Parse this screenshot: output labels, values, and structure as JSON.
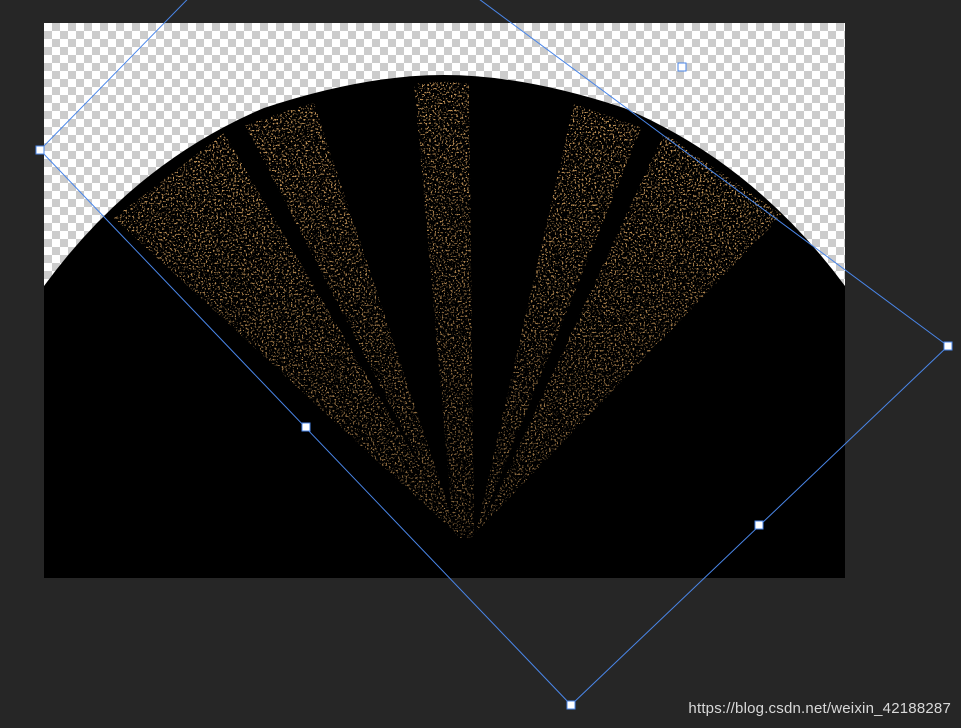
{
  "colors": {
    "workspace_bg": "#262626",
    "checker_light": "#ffffff",
    "checker_dark": "#cccccc",
    "image_fill": "#000000",
    "speckle": "#a0561c",
    "transform_box": "#4a86e8",
    "handle_fill": "#ffffff"
  },
  "canvas": {
    "layer_content": "fan-shaped sonar image on black"
  },
  "transform": {
    "handles": [
      "top-left",
      "top-middle",
      "top-right",
      "right-middle",
      "bottom-right",
      "bottom-middle",
      "bottom-left",
      "left-middle"
    ]
  },
  "watermark": {
    "text": "https://blog.csdn.net/weixin_42188287"
  }
}
